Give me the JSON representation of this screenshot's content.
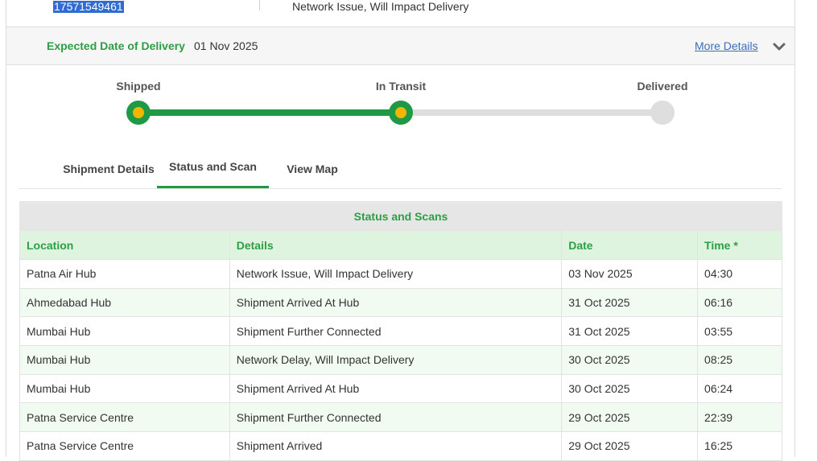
{
  "top": {
    "awb_number": "17571549461",
    "latest_status": "Network Issue, Will Impact Delivery"
  },
  "edd": {
    "label": "Expected Date of Delivery",
    "value": "01 Nov 2025",
    "more_details": "More Details",
    "chevron_icon": "chevron-down-icon"
  },
  "progress": {
    "steps": [
      {
        "label": "Shipped",
        "state": "done"
      },
      {
        "label": "In Transit",
        "state": "done"
      },
      {
        "label": "Delivered",
        "state": "pending"
      }
    ],
    "completed_fraction": 0.5,
    "colors": {
      "done": "#1e9a45",
      "center": "#f3b600",
      "pending": "#dedede"
    }
  },
  "tabs": [
    {
      "label": "Shipment Details",
      "active": false
    },
    {
      "label": "Status and Scan",
      "active": true
    },
    {
      "label": "View Map",
      "active": false
    }
  ],
  "scans": {
    "title": "Status and Scans",
    "columns": [
      "Location",
      "Details",
      "Date",
      "Time *"
    ],
    "rows": [
      [
        "Patna Air Hub",
        "Network Issue, Will Impact Delivery",
        "03 Nov 2025",
        "04:30"
      ],
      [
        "Ahmedabad Hub",
        "Shipment Arrived At Hub",
        "31 Oct 2025",
        "06:16"
      ],
      [
        "Mumbai Hub",
        "Shipment Further Connected",
        "31 Oct 2025",
        "03:55"
      ],
      [
        "Mumbai Hub",
        "Network Delay, Will Impact Delivery",
        "30 Oct 2025",
        "08:25"
      ],
      [
        "Mumbai Hub",
        "Shipment Arrived At Hub",
        "30 Oct 2025",
        "06:24"
      ],
      [
        "Patna Service Centre",
        "Shipment Further Connected",
        "29 Oct 2025",
        "22:39"
      ],
      [
        "Patna Service Centre",
        "Shipment Arrived",
        "29 Oct 2025",
        "16:25"
      ]
    ]
  }
}
